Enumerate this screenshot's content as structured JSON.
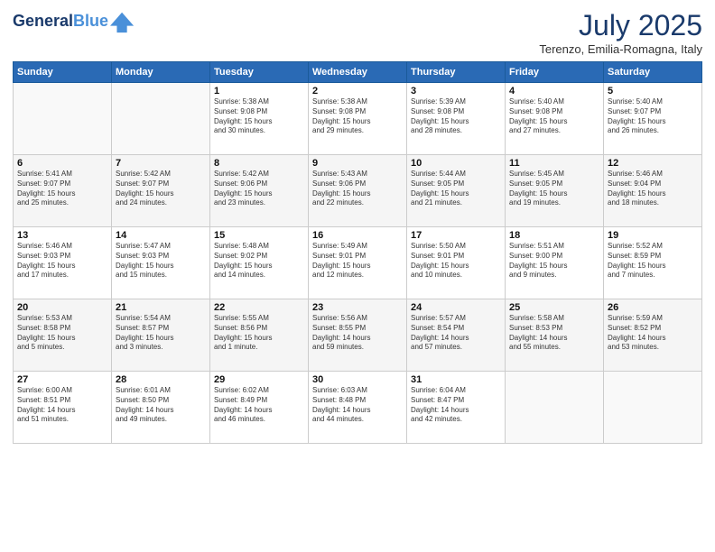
{
  "header": {
    "logo_line1": "General",
    "logo_line2": "Blue",
    "month": "July 2025",
    "location": "Terenzo, Emilia-Romagna, Italy"
  },
  "weekdays": [
    "Sunday",
    "Monday",
    "Tuesday",
    "Wednesday",
    "Thursday",
    "Friday",
    "Saturday"
  ],
  "weeks": [
    [
      {
        "day": "",
        "content": ""
      },
      {
        "day": "",
        "content": ""
      },
      {
        "day": "1",
        "content": "Sunrise: 5:38 AM\nSunset: 9:08 PM\nDaylight: 15 hours\nand 30 minutes."
      },
      {
        "day": "2",
        "content": "Sunrise: 5:38 AM\nSunset: 9:08 PM\nDaylight: 15 hours\nand 29 minutes."
      },
      {
        "day": "3",
        "content": "Sunrise: 5:39 AM\nSunset: 9:08 PM\nDaylight: 15 hours\nand 28 minutes."
      },
      {
        "day": "4",
        "content": "Sunrise: 5:40 AM\nSunset: 9:08 PM\nDaylight: 15 hours\nand 27 minutes."
      },
      {
        "day": "5",
        "content": "Sunrise: 5:40 AM\nSunset: 9:07 PM\nDaylight: 15 hours\nand 26 minutes."
      }
    ],
    [
      {
        "day": "6",
        "content": "Sunrise: 5:41 AM\nSunset: 9:07 PM\nDaylight: 15 hours\nand 25 minutes."
      },
      {
        "day": "7",
        "content": "Sunrise: 5:42 AM\nSunset: 9:07 PM\nDaylight: 15 hours\nand 24 minutes."
      },
      {
        "day": "8",
        "content": "Sunrise: 5:42 AM\nSunset: 9:06 PM\nDaylight: 15 hours\nand 23 minutes."
      },
      {
        "day": "9",
        "content": "Sunrise: 5:43 AM\nSunset: 9:06 PM\nDaylight: 15 hours\nand 22 minutes."
      },
      {
        "day": "10",
        "content": "Sunrise: 5:44 AM\nSunset: 9:05 PM\nDaylight: 15 hours\nand 21 minutes."
      },
      {
        "day": "11",
        "content": "Sunrise: 5:45 AM\nSunset: 9:05 PM\nDaylight: 15 hours\nand 19 minutes."
      },
      {
        "day": "12",
        "content": "Sunrise: 5:46 AM\nSunset: 9:04 PM\nDaylight: 15 hours\nand 18 minutes."
      }
    ],
    [
      {
        "day": "13",
        "content": "Sunrise: 5:46 AM\nSunset: 9:03 PM\nDaylight: 15 hours\nand 17 minutes."
      },
      {
        "day": "14",
        "content": "Sunrise: 5:47 AM\nSunset: 9:03 PM\nDaylight: 15 hours\nand 15 minutes."
      },
      {
        "day": "15",
        "content": "Sunrise: 5:48 AM\nSunset: 9:02 PM\nDaylight: 15 hours\nand 14 minutes."
      },
      {
        "day": "16",
        "content": "Sunrise: 5:49 AM\nSunset: 9:01 PM\nDaylight: 15 hours\nand 12 minutes."
      },
      {
        "day": "17",
        "content": "Sunrise: 5:50 AM\nSunset: 9:01 PM\nDaylight: 15 hours\nand 10 minutes."
      },
      {
        "day": "18",
        "content": "Sunrise: 5:51 AM\nSunset: 9:00 PM\nDaylight: 15 hours\nand 9 minutes."
      },
      {
        "day": "19",
        "content": "Sunrise: 5:52 AM\nSunset: 8:59 PM\nDaylight: 15 hours\nand 7 minutes."
      }
    ],
    [
      {
        "day": "20",
        "content": "Sunrise: 5:53 AM\nSunset: 8:58 PM\nDaylight: 15 hours\nand 5 minutes."
      },
      {
        "day": "21",
        "content": "Sunrise: 5:54 AM\nSunset: 8:57 PM\nDaylight: 15 hours\nand 3 minutes."
      },
      {
        "day": "22",
        "content": "Sunrise: 5:55 AM\nSunset: 8:56 PM\nDaylight: 15 hours\nand 1 minute."
      },
      {
        "day": "23",
        "content": "Sunrise: 5:56 AM\nSunset: 8:55 PM\nDaylight: 14 hours\nand 59 minutes."
      },
      {
        "day": "24",
        "content": "Sunrise: 5:57 AM\nSunset: 8:54 PM\nDaylight: 14 hours\nand 57 minutes."
      },
      {
        "day": "25",
        "content": "Sunrise: 5:58 AM\nSunset: 8:53 PM\nDaylight: 14 hours\nand 55 minutes."
      },
      {
        "day": "26",
        "content": "Sunrise: 5:59 AM\nSunset: 8:52 PM\nDaylight: 14 hours\nand 53 minutes."
      }
    ],
    [
      {
        "day": "27",
        "content": "Sunrise: 6:00 AM\nSunset: 8:51 PM\nDaylight: 14 hours\nand 51 minutes."
      },
      {
        "day": "28",
        "content": "Sunrise: 6:01 AM\nSunset: 8:50 PM\nDaylight: 14 hours\nand 49 minutes."
      },
      {
        "day": "29",
        "content": "Sunrise: 6:02 AM\nSunset: 8:49 PM\nDaylight: 14 hours\nand 46 minutes."
      },
      {
        "day": "30",
        "content": "Sunrise: 6:03 AM\nSunset: 8:48 PM\nDaylight: 14 hours\nand 44 minutes."
      },
      {
        "day": "31",
        "content": "Sunrise: 6:04 AM\nSunset: 8:47 PM\nDaylight: 14 hours\nand 42 minutes."
      },
      {
        "day": "",
        "content": ""
      },
      {
        "day": "",
        "content": ""
      }
    ]
  ]
}
